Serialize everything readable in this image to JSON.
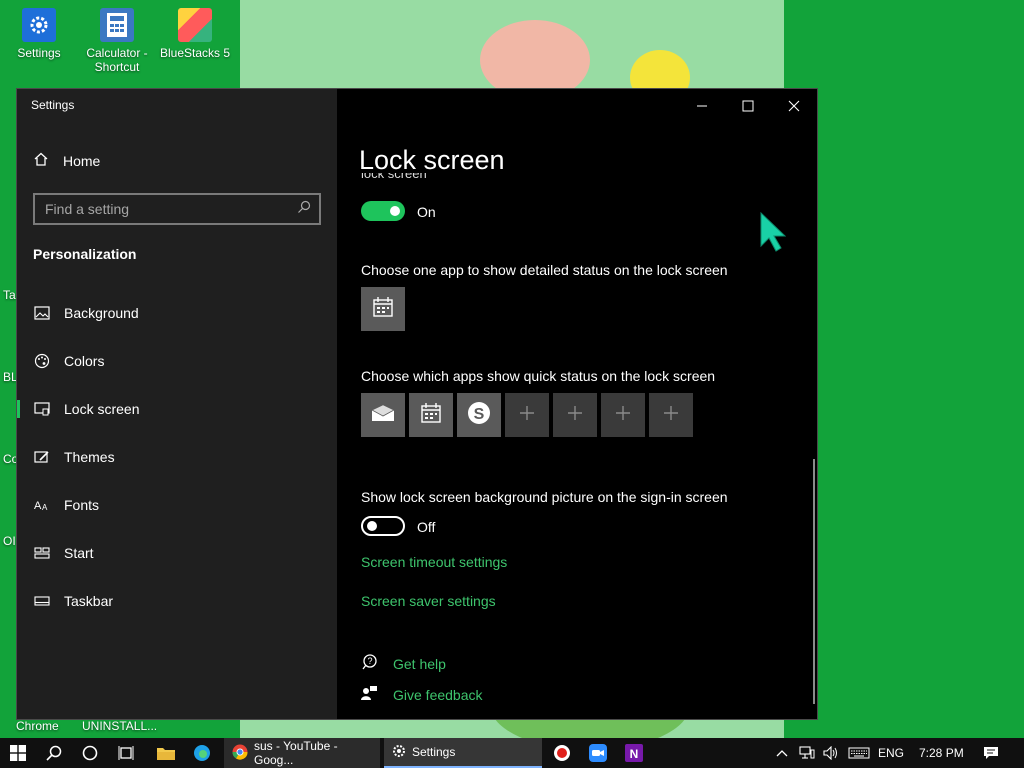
{
  "desktop": {
    "icons": [
      {
        "label": "Settings",
        "icon": "settings-gear-icon"
      },
      {
        "label": "Calculator - Shortcut",
        "icon": "calculator-icon"
      },
      {
        "label": "BlueStacks 5",
        "icon": "bluestacks-icon"
      }
    ],
    "fragments": [
      "Ta",
      "BL",
      "Co",
      "OI",
      "Chrome",
      "UNINSTALL..."
    ]
  },
  "window": {
    "title": "Settings",
    "controls": {
      "minimize": "minimize-icon",
      "maximize": "maximize-icon",
      "close": "close-icon"
    }
  },
  "sidebar": {
    "home_label": "Home",
    "search_placeholder": "Find a setting",
    "section_label": "Personalization",
    "items": [
      {
        "label": "Background",
        "icon": "picture-icon"
      },
      {
        "label": "Colors",
        "icon": "palette-icon"
      },
      {
        "label": "Lock screen",
        "icon": "lock-screen-icon",
        "active": true
      },
      {
        "label": "Themes",
        "icon": "brush-icon"
      },
      {
        "label": "Fonts",
        "icon": "font-icon"
      },
      {
        "label": "Start",
        "icon": "start-icon"
      },
      {
        "label": "Taskbar",
        "icon": "taskbar-icon"
      }
    ]
  },
  "content": {
    "page_title": "Lock screen",
    "clipped_label": "lock screen",
    "toggle1_state": "On",
    "detailed_status_label": "Choose one app to show detailed status on the lock screen",
    "quick_status_label": "Choose which apps show quick status on the lock screen",
    "quick_status_tiles": [
      "mail-icon",
      "calendar-icon",
      "skype-icon",
      "plus-icon",
      "plus-icon",
      "plus-icon",
      "plus-icon"
    ],
    "signin_label": "Show lock screen background picture on the sign-in screen",
    "toggle2_state": "Off",
    "screen_timeout_link": "Screen timeout settings",
    "screen_saver_link": "Screen saver settings",
    "get_help": "Get help",
    "give_feedback": "Give feedback"
  },
  "taskbar": {
    "chrome_task": "sus - YouTube - Goog...",
    "settings_task": "Settings",
    "language": "ENG",
    "time": "7:28 PM"
  },
  "colors": {
    "accent": "#1ec45c",
    "link": "#3ec46d",
    "desktop": "#12a33a"
  }
}
